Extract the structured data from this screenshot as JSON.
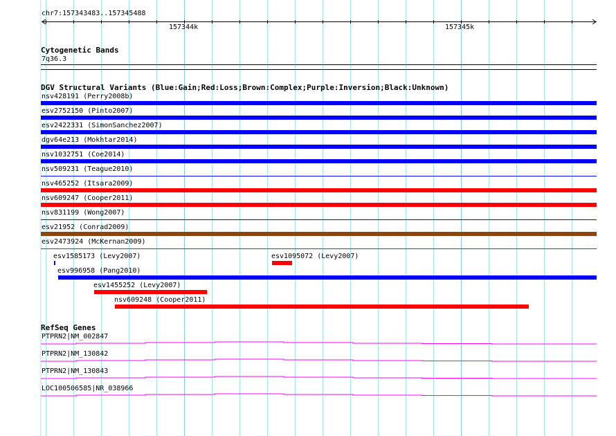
{
  "ruler": {
    "range_label": "chr7:157343483..157345488",
    "ticks": [
      "157344k",
      "157345k"
    ]
  },
  "cytoband": {
    "title": "Cytogenetic Bands",
    "band": "7q36.3"
  },
  "dgv": {
    "title": "DGV Structural Variants (Blue:Gain;Red:Loss;Brown:Complex;Purple:Inversion;Black:Unknown)",
    "colors": {
      "gain": "#0000ff",
      "loss": "#ff0000",
      "complex": "#8b4513"
    },
    "full_rows": [
      {
        "label": "nsv428191 (Perry2008b)",
        "type": "gain",
        "style": "thick"
      },
      {
        "label": "esv2752150 (Pinto2007)",
        "type": "gain",
        "style": "thick"
      },
      {
        "label": "esv2422331 (SimonSanchez2007)",
        "type": "gain",
        "style": "thick"
      },
      {
        "label": "dgv64e213 (Mokhtar2014)",
        "type": "gain",
        "style": "thick"
      },
      {
        "label": "nsv1032751 (Coe2014)",
        "type": "gain",
        "style": "thick"
      },
      {
        "label": "nsv509231 (Teague2010)",
        "type": "gain",
        "style": "thin"
      },
      {
        "label": "nsv465252 (Itsara2009)",
        "type": "loss",
        "style": "thick"
      },
      {
        "label": "nsv609247 (Cooper2011)",
        "type": "loss",
        "style": "thick"
      },
      {
        "label": "nsv831199 (Wong2007)",
        "type": "gain",
        "style": "thin"
      },
      {
        "label": "esv21952 (Conrad2009)",
        "type": "complex",
        "style": "thick"
      },
      {
        "label": "esv2473924 (McKernan2009)",
        "type": "loss",
        "style": "thin"
      }
    ],
    "partial_rows": [
      {
        "label": "esv1585173 (Levy2007)",
        "type": "gain"
      },
      {
        "label": "esv1095072 (Levy2007)",
        "type": "loss"
      },
      {
        "label": "esv996958 (Pang2010)",
        "type": "gain"
      },
      {
        "label": "esv1455252 (Levy2007)",
        "type": "loss"
      },
      {
        "label": "nsv609248 (Cooper2011)",
        "type": "loss"
      }
    ]
  },
  "refseq": {
    "title": "RefSeq Genes",
    "color": "#ff00ff",
    "genes": [
      {
        "label": "PTPRN2|NM_002847"
      },
      {
        "label": "PTPRN2|NM_130842"
      },
      {
        "label": "PTPRN2|NM_130843"
      },
      {
        "label": "LOC100506585|NR_038966"
      }
    ]
  }
}
